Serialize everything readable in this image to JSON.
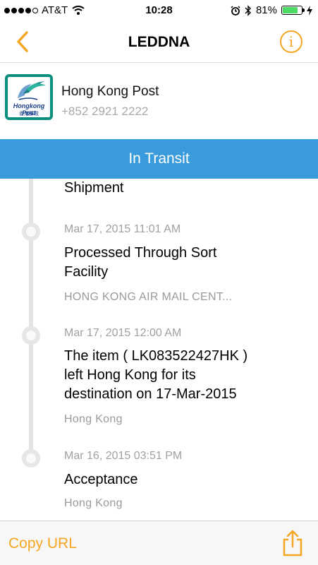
{
  "status_bar": {
    "carrier": "AT&T",
    "time": "10:28",
    "battery": "81%",
    "battery_level": 0.81,
    "signal_bars": 4
  },
  "nav": {
    "title": "LEDDNA",
    "back_icon": "chevron-left-icon",
    "info_icon": "info-icon",
    "info_glyph": "i",
    "accent_color": "#f5a623"
  },
  "carrier_info": {
    "name": "Hong Kong Post",
    "phone": "+852 2921 2222",
    "logo": {
      "label": "Hongkong Post",
      "sub": "香港郵政",
      "color": "#0a8f7f"
    }
  },
  "tracking_status": {
    "label": "In Transit",
    "color": "#3a9bdc"
  },
  "events": [
    {
      "time": "",
      "title": "Shipment",
      "location": ""
    },
    {
      "time": "Mar 17, 2015 11:01 AM",
      "title": "Processed Through Sort\nFacility",
      "location": "HONG KONG AIR MAIL CENT..."
    },
    {
      "time": "Mar 17, 2015 12:00 AM",
      "title": "The item ( LK083522427HK )\nleft Hong Kong for its\ndestination on  17-Mar-2015",
      "location": "Hong Kong"
    },
    {
      "time": "Mar 16, 2015 03:51 PM",
      "title": "Acceptance",
      "location": "Hong Kong"
    }
  ],
  "bottom": {
    "copy_url": "Copy URL",
    "share_icon": "share-icon"
  }
}
